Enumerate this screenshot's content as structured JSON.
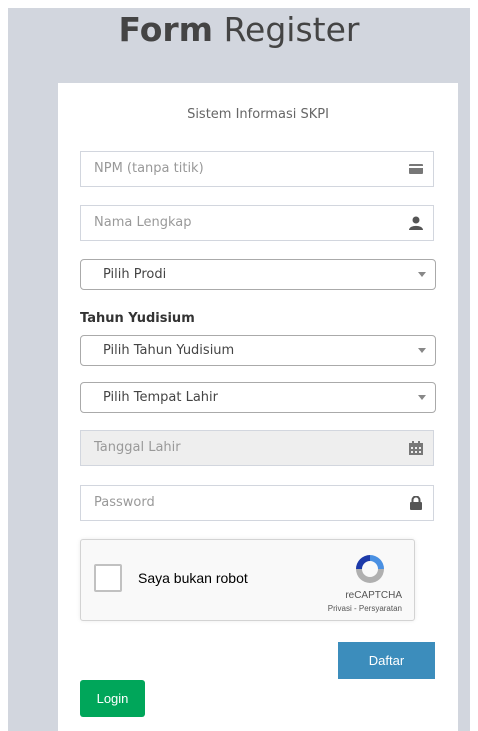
{
  "header": {
    "title_bold": "Form",
    "title_light": "Register"
  },
  "form": {
    "subtitle": "Sistem Informasi SKPI",
    "npm": {
      "placeholder": "NPM (tanpa titik)",
      "icon": "id-card-icon"
    },
    "nama": {
      "placeholder": "Nama Lengkap",
      "icon": "user-icon"
    },
    "prodi": {
      "selected": "Pilih Prodi"
    },
    "tahun_label": "Tahun Yudisium",
    "tahun": {
      "selected": "Pilih Tahun Yudisium"
    },
    "tempat": {
      "selected": "Pilih Tempat Lahir"
    },
    "tanggal": {
      "placeholder": "Tanggal Lahir",
      "icon": "calendar-icon"
    },
    "password": {
      "placeholder": "Password",
      "icon": "lock-icon"
    }
  },
  "captcha": {
    "label": "Saya bukan robot",
    "brand": "reCAPTCHA",
    "links": "Privasi - Persyaratan"
  },
  "buttons": {
    "daftar": "Daftar",
    "login": "Login"
  },
  "colors": {
    "primary": "#3c8dbc",
    "success": "#00a65a",
    "background": "#d2d6de"
  }
}
